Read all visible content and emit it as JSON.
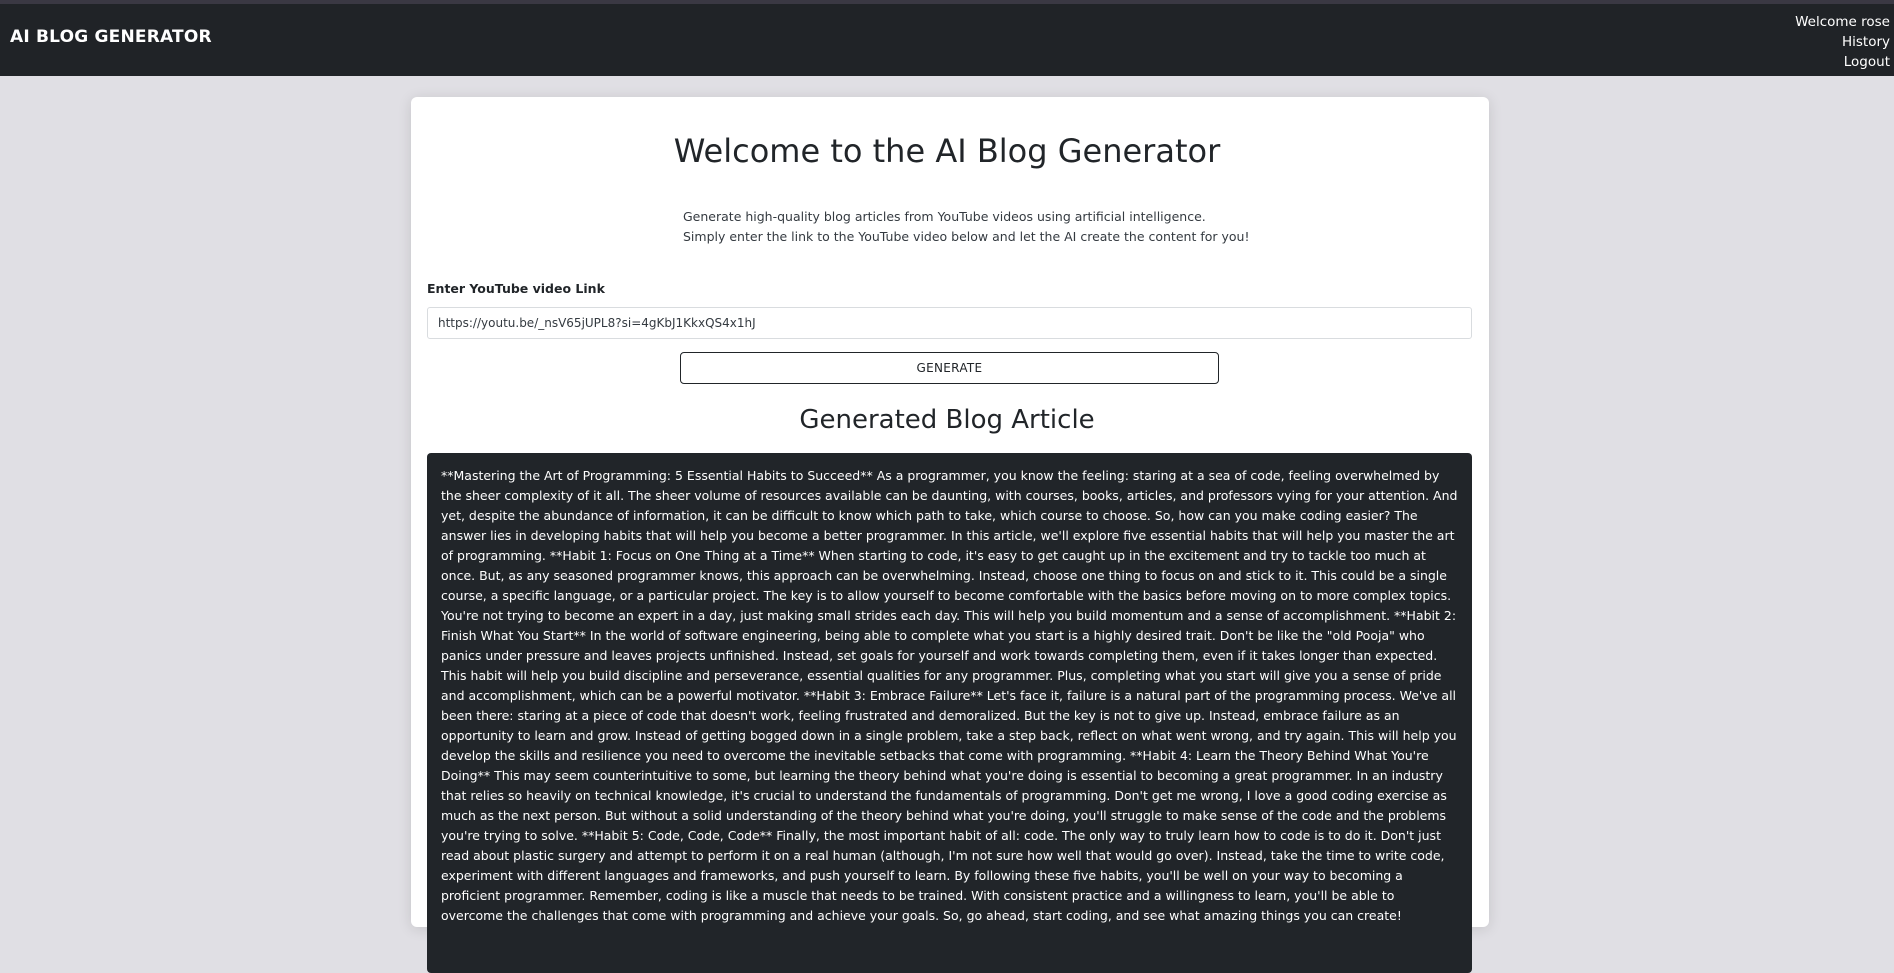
{
  "navbar": {
    "brand": "AI BLOG GENERATOR",
    "welcome": "Welcome rose",
    "history": "History",
    "logout": "Logout"
  },
  "hero": {
    "title": "Welcome to the AI Blog Generator",
    "desc_line1": "Generate high-quality blog articles from YouTube videos using artificial intelligence.",
    "desc_line2": "Simply enter the link to the YouTube video below and let the AI create the content for you!"
  },
  "form": {
    "label": "Enter YouTube video Link",
    "input_value": "https://youtu.be/_nsV65jUPL8?si=4gKbJ1KkxQS4x1hJ",
    "button_label": "GENERATE"
  },
  "result": {
    "heading": "Generated Blog Article",
    "content": "**Mastering the Art of Programming: 5 Essential Habits to Succeed** As a programmer, you know the feeling: staring at a sea of code, feeling overwhelmed by the sheer complexity of it all. The sheer volume of resources available can be daunting, with courses, books, articles, and professors vying for your attention. And yet, despite the abundance of information, it can be difficult to know which path to take, which course to choose. So, how can you make coding easier? The answer lies in developing habits that will help you become a better programmer. In this article, we'll explore five essential habits that will help you master the art of programming. **Habit 1: Focus on One Thing at a Time** When starting to code, it's easy to get caught up in the excitement and try to tackle too much at once. But, as any seasoned programmer knows, this approach can be overwhelming. Instead, choose one thing to focus on and stick to it. This could be a single course, a specific language, or a particular project. The key is to allow yourself to become comfortable with the basics before moving on to more complex topics. You're not trying to become an expert in a day, just making small strides each day. This will help you build momentum and a sense of accomplishment. **Habit 2: Finish What You Start** In the world of software engineering, being able to complete what you start is a highly desired trait. Don't be like the \"old Pooja\" who panics under pressure and leaves projects unfinished. Instead, set goals for yourself and work towards completing them, even if it takes longer than expected. This habit will help you build discipline and perseverance, essential qualities for any programmer. Plus, completing what you start will give you a sense of pride and accomplishment, which can be a powerful motivator. **Habit 3: Embrace Failure** Let's face it, failure is a natural part of the programming process. We've all been there: staring at a piece of code that doesn't work, feeling frustrated and demoralized. But the key is not to give up. Instead, embrace failure as an opportunity to learn and grow. Instead of getting bogged down in a single problem, take a step back, reflect on what went wrong, and try again. This will help you develop the skills and resilience you need to overcome the inevitable setbacks that come with programming. **Habit 4: Learn the Theory Behind What You're Doing** This may seem counterintuitive to some, but learning the theory behind what you're doing is essential to becoming a great programmer. In an industry that relies so heavily on technical knowledge, it's crucial to understand the fundamentals of programming. Don't get me wrong, I love a good coding exercise as much as the next person. But without a solid understanding of the theory behind what you're doing, you'll struggle to make sense of the code and the problems you're trying to solve. **Habit 5: Code, Code, Code** Finally, the most important habit of all: code. The only way to truly learn how to code is to do it. Don't just read about plastic surgery and attempt to perform it on a real human (although, I'm not sure how well that would go over). Instead, take the time to write code, experiment with different languages and frameworks, and push yourself to learn. By following these five habits, you'll be well on your way to becoming a proficient programmer. Remember, coding is like a muscle that needs to be trained. With consistent practice and a willingness to learn, you'll be able to overcome the challenges that come with programming and achieve your goals. So, go ahead, start coding, and see what amazing things you can create!"
  }
}
